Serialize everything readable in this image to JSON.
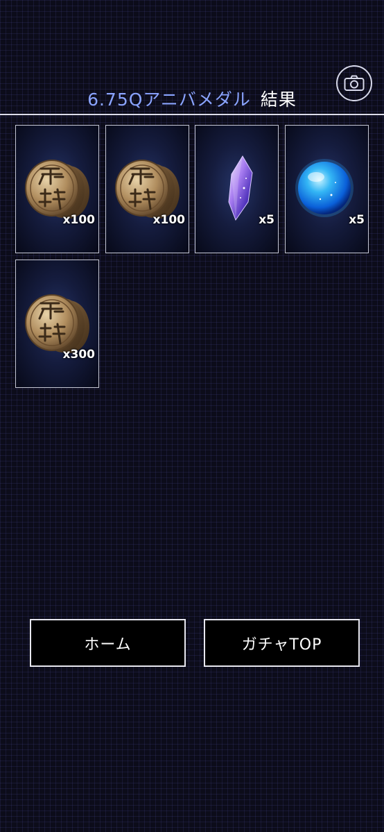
{
  "header": {
    "title_accent": "6.75Qアニバメダル",
    "title_suffix": "結果",
    "camera_icon": "camera-icon"
  },
  "results": [
    {
      "item": "coin",
      "icon": "coin-icon",
      "quantity": "x100"
    },
    {
      "item": "coin",
      "icon": "coin-icon",
      "quantity": "x100"
    },
    {
      "item": "crystal",
      "icon": "crystal-icon",
      "quantity": "x5"
    },
    {
      "item": "orb",
      "icon": "orb-icon",
      "quantity": "x5"
    },
    {
      "item": "coin",
      "icon": "coin-icon",
      "quantity": "x300"
    }
  ],
  "buttons": {
    "home_label": "ホーム",
    "gacha_top_label": "ガチャTOP"
  },
  "colors": {
    "accent": "#8aa4ff",
    "background": "#0c0c1a",
    "card_border": "#c6c8d6"
  }
}
